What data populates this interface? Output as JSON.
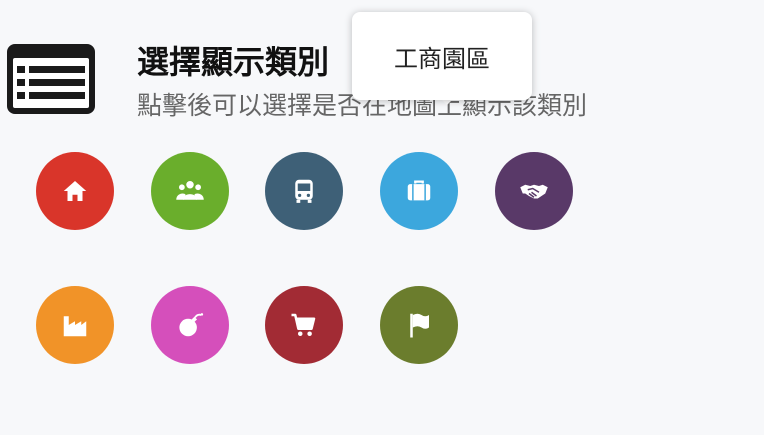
{
  "header": {
    "title": "選擇顯示類別",
    "subtitle": "點擊後可以選擇是否在地圖上顯示該類別",
    "icon": "list-icon"
  },
  "tooltip": {
    "text": "工商園區"
  },
  "categories": [
    {
      "icon": "home-icon",
      "color": "#d9352a"
    },
    {
      "icon": "people-group-icon",
      "color": "#6aae2c"
    },
    {
      "icon": "bus-icon",
      "color": "#3e6077"
    },
    {
      "icon": "briefcase-icon",
      "color": "#3ca7dd"
    },
    {
      "icon": "handshake-icon",
      "color": "#593968"
    },
    {
      "icon": "factory-icon",
      "color": "#f19328"
    },
    {
      "icon": "bomb-icon",
      "color": "#d54fbb"
    },
    {
      "icon": "shopping-cart-icon",
      "color": "#a22b34"
    },
    {
      "icon": "flag-icon",
      "color": "#6b7d2d"
    }
  ]
}
